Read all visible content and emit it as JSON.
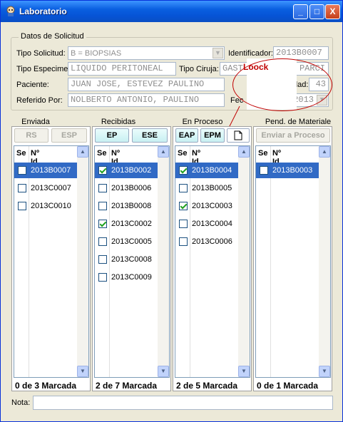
{
  "window": {
    "title": "Laboratorio",
    "minimize": "_",
    "maximize": "□",
    "close": "X"
  },
  "solicitud": {
    "group_title": "Datos de Solicitud",
    "tipo_solicitud_label": "Tipo Solicitud:",
    "tipo_solicitud_value": "B = BIOPSIAS",
    "identificador_label": "Identificador:",
    "identificador_value": "2013B0007",
    "tipo_especimen_label": "Tipo Especimen",
    "tipo_especimen_value": "LIQUIDO PERITONEAL",
    "tipo_cirugia_label": "Tipo Ciruja:",
    "tipo_cirugia_value": "GAST",
    "tipo_cirugia_value_tail": "PARCI",
    "paciente_label": "Paciente:",
    "paciente_value": "JUAN JOSE, ESTEVEZ PAULINO",
    "edad_label": "dad:",
    "edad_value": "43",
    "referido_label": "Referido Por:",
    "referido_value": "NOLBERTO ANTONIO, PAULINO",
    "fecha_label": "Fec",
    "fecha_value": "2013"
  },
  "annotation": {
    "text": "Loock"
  },
  "columns": [
    {
      "title": "Enviada",
      "buttons": [
        {
          "label": "RS",
          "enabled": false
        },
        {
          "label": "ESP",
          "enabled": false
        }
      ],
      "head_se": "Se",
      "head_id": "Nº Id.",
      "rows": [
        {
          "id": "2013B0007",
          "checked": false,
          "selected": true
        },
        {
          "id": "2013C0007",
          "checked": false,
          "selected": false
        },
        {
          "id": "2013C0010",
          "checked": false,
          "selected": false
        }
      ],
      "count": "0 de 3 Marcada"
    },
    {
      "title": "Recibidas",
      "buttons": [
        {
          "label": "EP",
          "enabled": true
        },
        {
          "label": "ESE",
          "enabled": true
        }
      ],
      "head_se": "Se",
      "head_id": "Nº Id.",
      "rows": [
        {
          "id": "2013B0002",
          "checked": true,
          "selected": true
        },
        {
          "id": "2013B0006",
          "checked": false,
          "selected": false
        },
        {
          "id": "2013B0008",
          "checked": false,
          "selected": false
        },
        {
          "id": "2013C0002",
          "checked": true,
          "selected": false
        },
        {
          "id": "2013C0005",
          "checked": false,
          "selected": false
        },
        {
          "id": "2013C0008",
          "checked": false,
          "selected": false
        },
        {
          "id": "2013C0009",
          "checked": false,
          "selected": false
        }
      ],
      "count": "2 de 7 Marcada"
    },
    {
      "title": "En Proceso",
      "buttons": [
        {
          "label": "EAP",
          "enabled": true
        },
        {
          "label": "EPM",
          "enabled": true
        },
        {
          "label": "",
          "enabled": true,
          "icon": "document-icon"
        }
      ],
      "head_se": "Se",
      "head_id": "Nº Id.",
      "rows": [
        {
          "id": "2013B0004",
          "checked": true,
          "selected": true
        },
        {
          "id": "2013B0005",
          "checked": false,
          "selected": false
        },
        {
          "id": "2013C0003",
          "checked": true,
          "selected": false
        },
        {
          "id": "2013C0004",
          "checked": false,
          "selected": false
        },
        {
          "id": "2013C0006",
          "checked": false,
          "selected": false
        }
      ],
      "count": "2 de 5 Marcada"
    },
    {
      "title": "Pend. de Materiale",
      "buttons": [
        {
          "label": "Enviar a Proceso",
          "enabled": false
        }
      ],
      "head_se": "Se",
      "head_id": "Nº Id.",
      "rows": [
        {
          "id": "2013B0003",
          "checked": false,
          "selected": true
        }
      ],
      "count": "0 de 1 Marcada"
    }
  ],
  "nota": {
    "label": "Nota:",
    "value": ""
  }
}
